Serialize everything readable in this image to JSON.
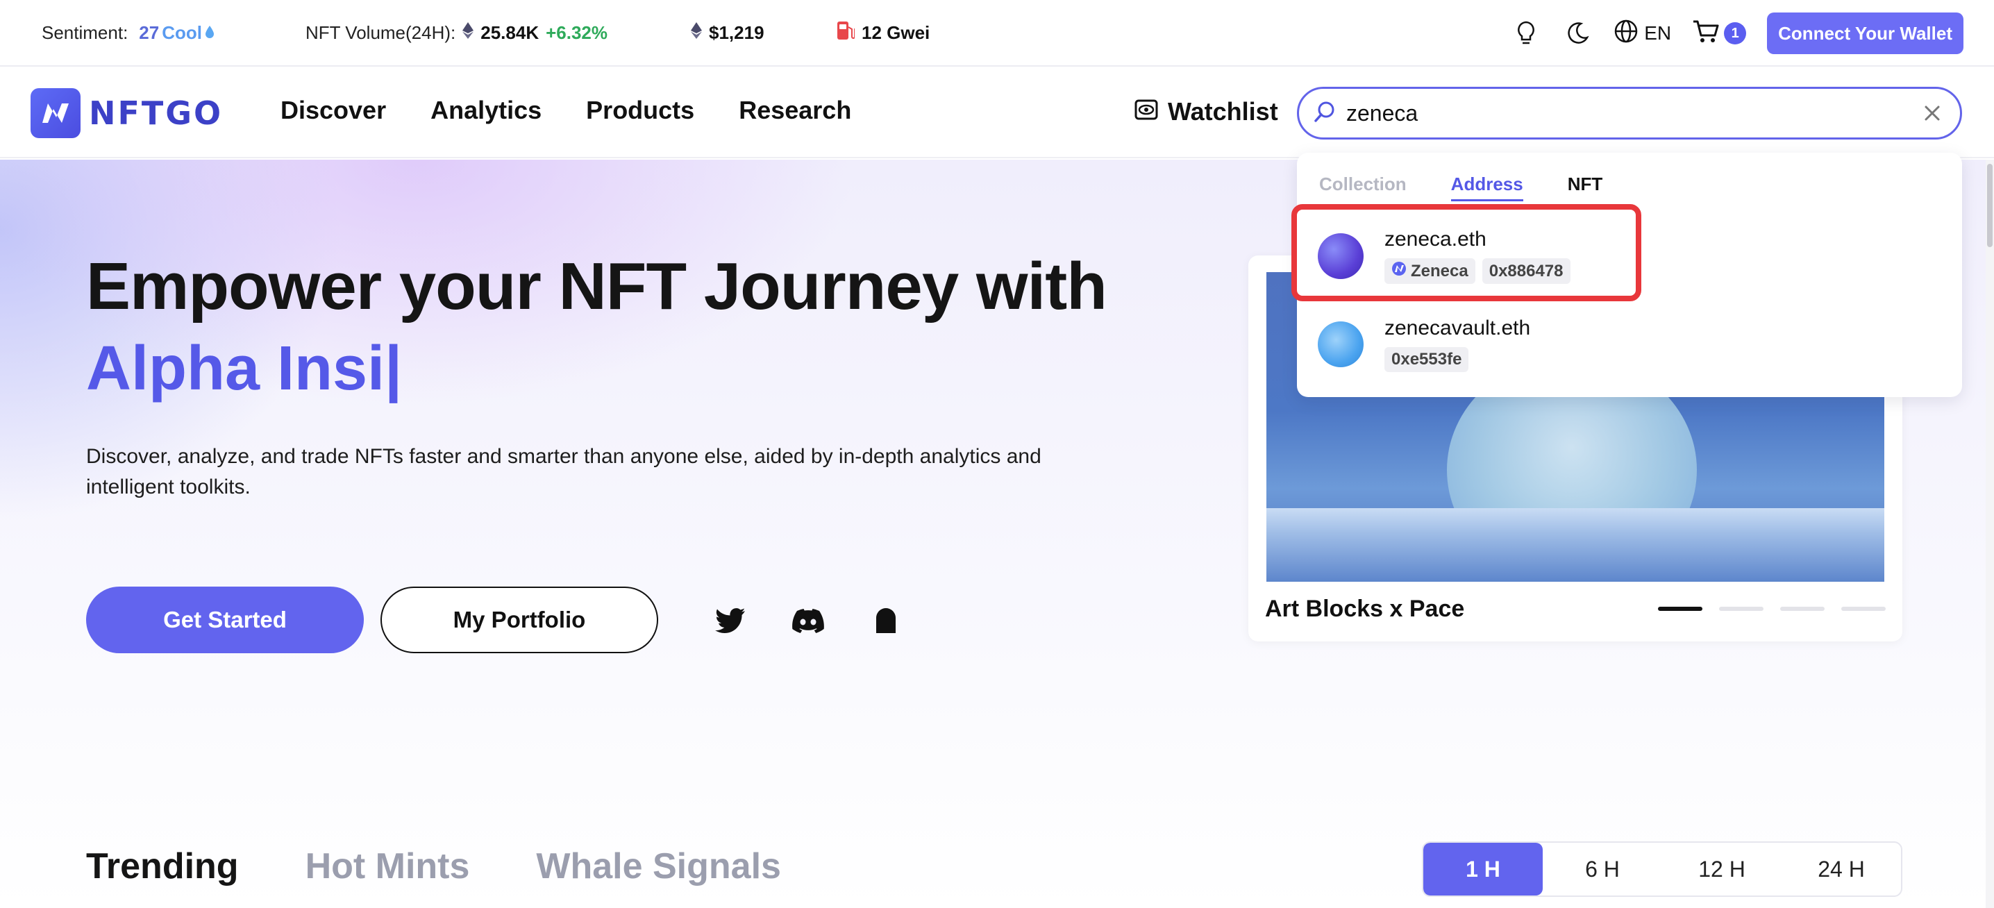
{
  "topbar": {
    "sentiment_label": "Sentiment:",
    "sentiment_value": "27",
    "sentiment_status": "Cool",
    "volume_label": "NFT Volume(24H):",
    "volume_value": "25.84K",
    "volume_change": "+6.32%",
    "eth_price": "$1,219",
    "gas": "12 Gwei",
    "language": "EN",
    "cart_count": "1",
    "connect_label": "Connect Your Wallet"
  },
  "nav": {
    "logo_text": "NFTGO",
    "links": [
      "Discover",
      "Analytics",
      "Products",
      "Research"
    ],
    "watchlist_label": "Watchlist"
  },
  "search": {
    "value": "zeneca"
  },
  "dropdown": {
    "tabs": [
      "Collection",
      "Address",
      "NFT"
    ],
    "active_tab": "Address",
    "results": [
      {
        "name": "zeneca.eth",
        "tag_name": "Zeneca",
        "address": "0x886478"
      },
      {
        "name": "zenecavault.eth",
        "address": "0xe553fe"
      }
    ]
  },
  "hero": {
    "headline": "Empower your NFT Journey with",
    "headline_accent": "Alpha Insi|",
    "description": "Discover, analyze, and trade NFTs faster and smarter than anyone else, aided by in-depth analytics and intelligent toolkits.",
    "primary_button": "Get Started",
    "secondary_button": "My Portfolio"
  },
  "featured": {
    "title": "Art Blocks x Pace",
    "active_slide": 1,
    "total_slides": 4
  },
  "sections": {
    "tabs": [
      "Trending",
      "Hot Mints",
      "Whale Signals"
    ],
    "time_ranges": [
      "1 H",
      "6 H",
      "12 H",
      "24 H"
    ],
    "active_time": "1 H"
  },
  "colors": {
    "brand": "#6264ee",
    "positive": "#2eaa5a",
    "highlight": "#e8373b"
  }
}
